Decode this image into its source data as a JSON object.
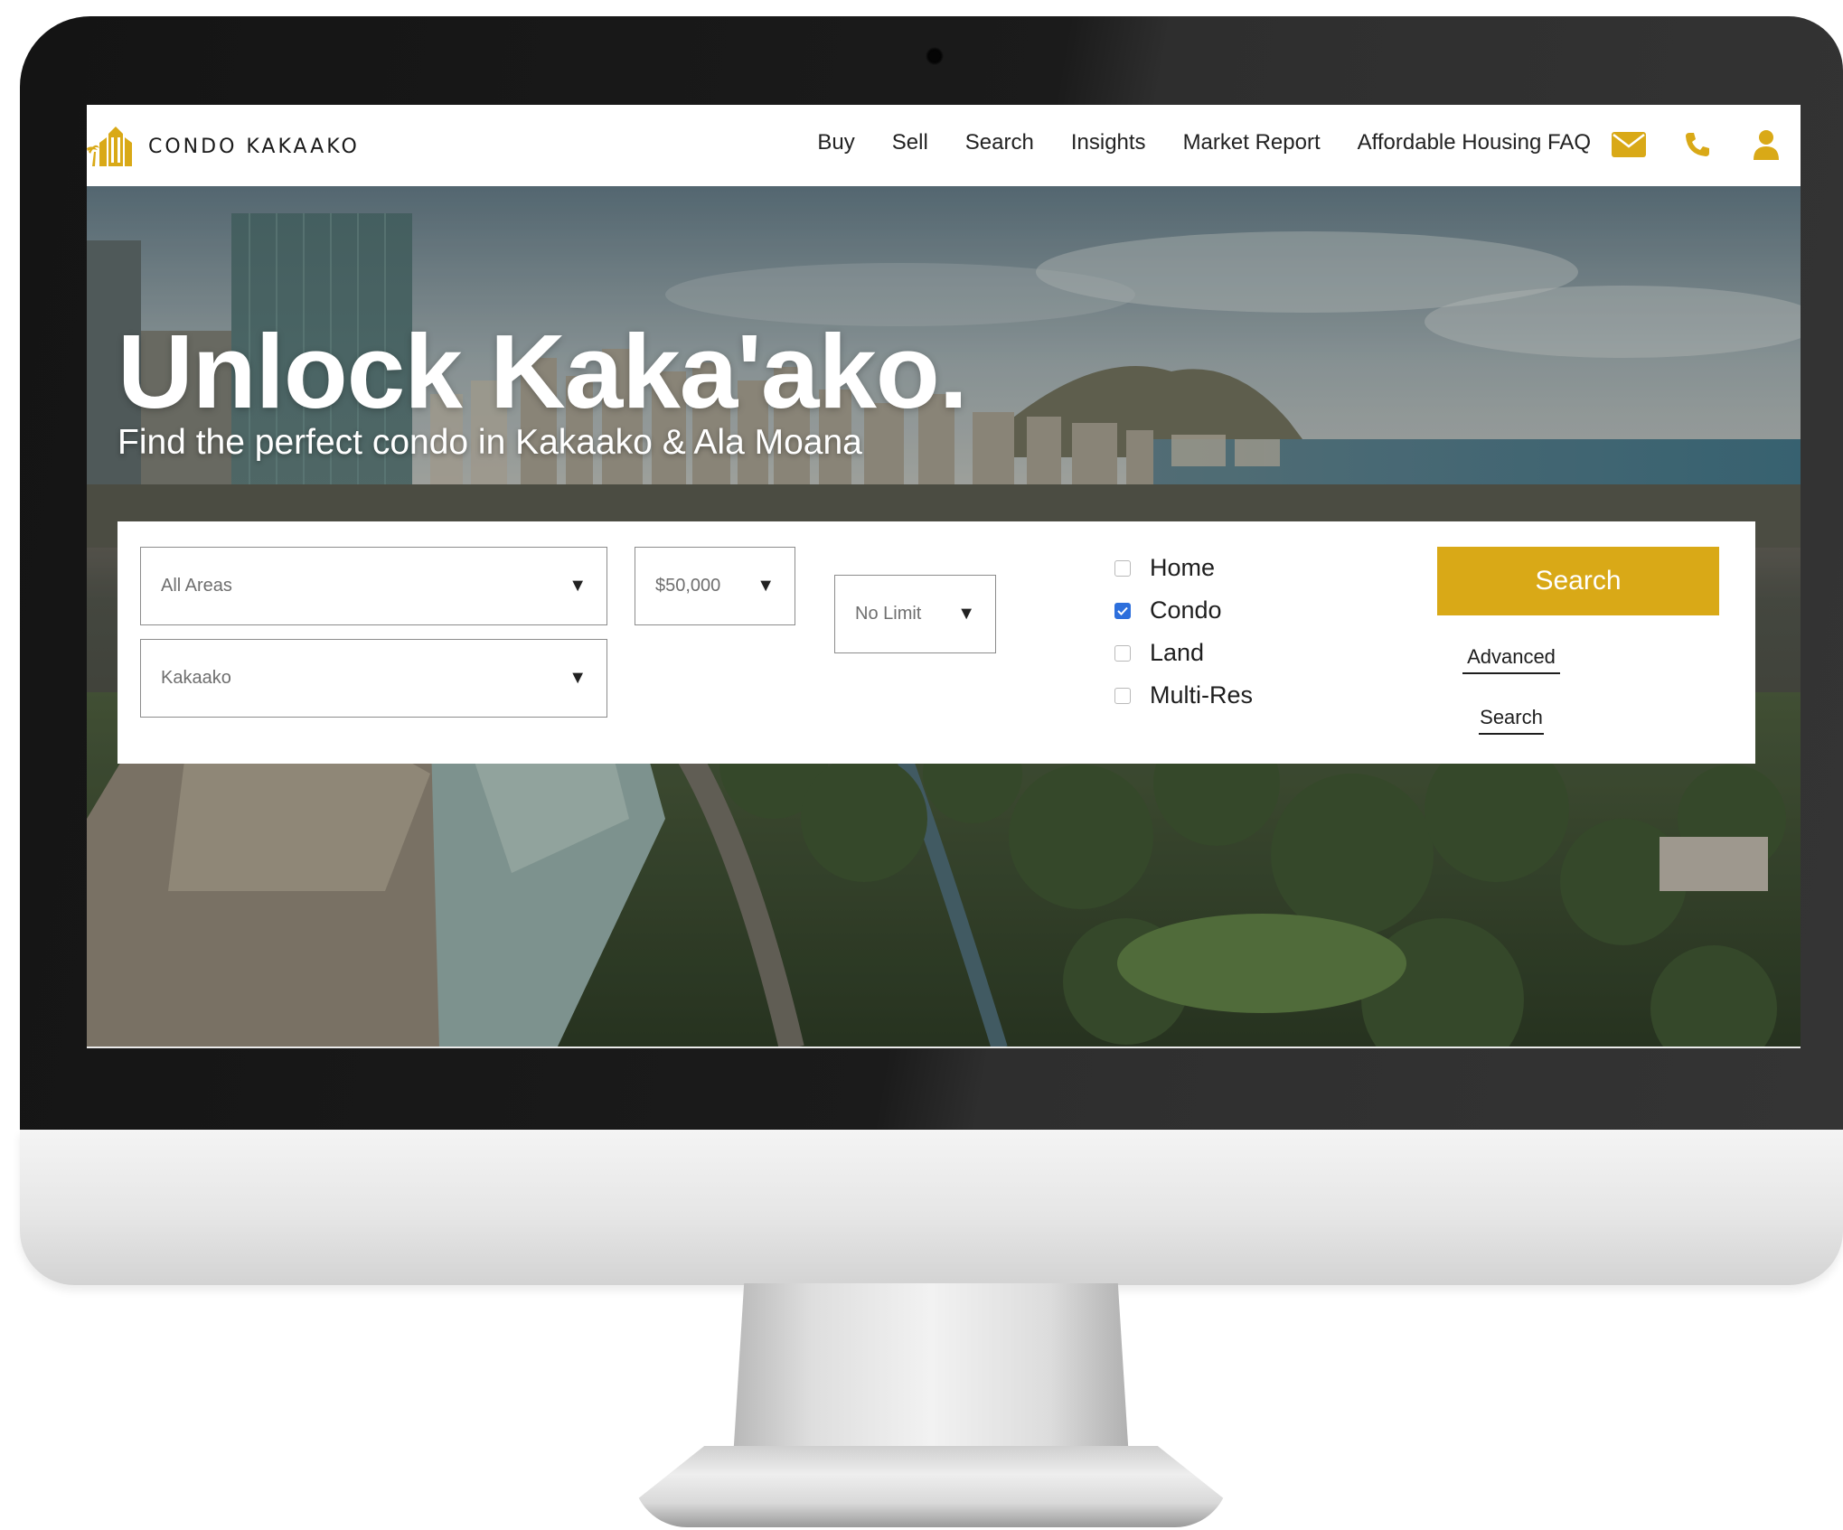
{
  "brand": {
    "name": "CONDO KAKAAKO",
    "accent_color": "#D9A917"
  },
  "nav": {
    "links": [
      "Buy",
      "Sell",
      "Search",
      "Insights",
      "Market Report",
      "Affordable Housing FAQ"
    ],
    "icons": [
      "mail-icon",
      "phone-icon",
      "user-icon"
    ]
  },
  "hero": {
    "title": "Unlock Kaka'ako.",
    "subtitle": "Find the perfect condo in Kakaako & Ala Moana"
  },
  "search": {
    "area_select": "All Areas",
    "neighborhood_select": "Kakaako",
    "price_min": "$50,000",
    "price_max": "No Limit",
    "property_types": [
      {
        "label": "Home",
        "checked": false
      },
      {
        "label": "Condo",
        "checked": true
      },
      {
        "label": "Land",
        "checked": false
      },
      {
        "label": "Multi-Res",
        "checked": false
      }
    ],
    "search_button": "Search",
    "advanced_link": {
      "line1": "Advanced",
      "line2": "Search"
    }
  }
}
